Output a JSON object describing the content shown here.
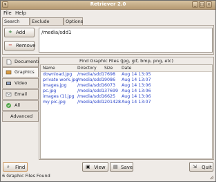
{
  "window": {
    "title": "Retriever 2.0"
  },
  "menu": [
    "File",
    "Help"
  ],
  "tabs": [
    "Search path",
    "Exclude paths",
    "Options"
  ],
  "path_panel": {
    "add_label": "Add",
    "remove_label": "Remove",
    "paths": [
      "/media/sdd1"
    ]
  },
  "sidebar": [
    {
      "label": "Documents",
      "icon": "document-icon"
    },
    {
      "label": "Graphics",
      "icon": "image-icon"
    },
    {
      "label": "Video",
      "icon": "video-icon"
    },
    {
      "label": "Email",
      "icon": "email-icon"
    },
    {
      "label": "All",
      "icon": "all-files-icon"
    },
    {
      "label": "Advanced",
      "icon": ""
    }
  ],
  "results": {
    "title": "Find Graphic Files (jpg, gif, bmp, png, etc)",
    "columns": [
      "Name",
      "Directory",
      "Size",
      "Date"
    ],
    "rows": [
      [
        "download.jpg",
        "/media/sdd1",
        "7698",
        "Aug 14 13:05"
      ],
      [
        "private work.jpg",
        "/media/sdd1",
        "9086",
        "Aug 14 13:07"
      ],
      [
        "images.jpg",
        "/media/sdd1",
        "6073",
        "Aug 14 13:06"
      ],
      [
        "pc.jpg",
        "/media/sdd1",
        "37699",
        "Aug 14 13:06"
      ],
      [
        "images (1).jpg",
        "/media/sdd1",
        "6625",
        "Aug 14 13:06"
      ],
      [
        "my pic.jpg",
        "/media/sdd1",
        "201428",
        "Aug 14 13:07"
      ]
    ]
  },
  "buttons": {
    "find": "Find",
    "view": "View",
    "save": "Save",
    "quit": "Quit"
  },
  "status": "6 Graphic Files Found",
  "colors": {
    "accent": "#c8945c",
    "link": "#2b45c9"
  }
}
